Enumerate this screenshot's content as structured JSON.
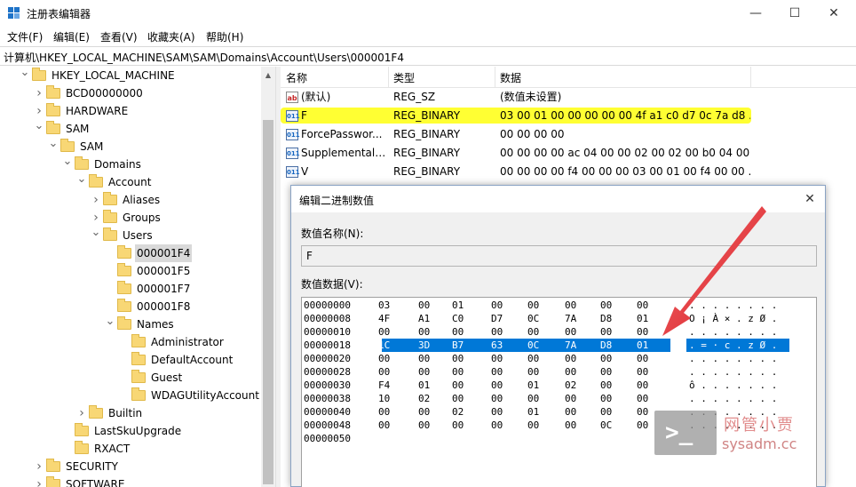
{
  "window": {
    "title": "注册表编辑器",
    "minimize_glyph": "—",
    "maximize_glyph": "☐",
    "close_glyph": "✕",
    "icon": "registry-editor-icon"
  },
  "menu": [
    "文件(F)",
    "编辑(E)",
    "查看(V)",
    "收藏夹(A)",
    "帮助(H)"
  ],
  "address": "计算机\\HKEY_LOCAL_MACHINE\\SAM\\SAM\\Domains\\Account\\Users\\000001F4",
  "tree": [
    {
      "label": "HKEY_LOCAL_MACHINE",
      "chev": "v"
    },
    {
      "label": "BCD00000000",
      "chev": ">"
    },
    {
      "label": "HARDWARE",
      "chev": ">"
    },
    {
      "label": "SAM",
      "chev": "v"
    },
    {
      "label": "SAM",
      "chev": "v"
    },
    {
      "label": "Domains",
      "chev": "v"
    },
    {
      "label": "Account",
      "chev": "v"
    },
    {
      "label": "Aliases",
      "chev": ">"
    },
    {
      "label": "Groups",
      "chev": ">"
    },
    {
      "label": "Users",
      "chev": "v"
    },
    {
      "label": "000001F4",
      "chev": ""
    },
    {
      "label": "000001F5",
      "chev": ""
    },
    {
      "label": "000001F7",
      "chev": ""
    },
    {
      "label": "000001F8",
      "chev": ""
    },
    {
      "label": "Names",
      "chev": "v"
    },
    {
      "label": "Administrator",
      "chev": ""
    },
    {
      "label": "DefaultAccount",
      "chev": ""
    },
    {
      "label": "Guest",
      "chev": ""
    },
    {
      "label": "WDAGUtilityAccount",
      "chev": ""
    },
    {
      "label": "Builtin",
      "chev": ">"
    },
    {
      "label": "LastSkuUpgrade",
      "chev": ""
    },
    {
      "label": "RXACT",
      "chev": ""
    },
    {
      "label": "SECURITY",
      "chev": ">"
    },
    {
      "label": "SOFTWARE",
      "chev": ">"
    }
  ],
  "list": {
    "headers": {
      "name": "名称",
      "type": "类型",
      "data": "数据"
    },
    "rows": [
      {
        "icon": "ab",
        "name": "(默认)",
        "type": "REG_SZ",
        "data": "(数值未设置)"
      },
      {
        "icon": "011",
        "name": "F",
        "type": "REG_BINARY",
        "data": "03 00 01 00 00 00 00 00 4f a1 c0 d7 0c 7a d8 ..."
      },
      {
        "icon": "011",
        "name": "ForcePasswor...",
        "type": "REG_BINARY",
        "data": "00 00 00 00"
      },
      {
        "icon": "011",
        "name": "SupplementalC...",
        "type": "REG_BINARY",
        "data": "00 00 00 00 ac 04 00 00 02 00 02 00 b0 04 00..."
      },
      {
        "icon": "011",
        "name": "V",
        "type": "REG_BINARY",
        "data": "00 00 00 00 f4 00 00 00 03 00 01 00 f4 00 00 ..."
      }
    ]
  },
  "dialog": {
    "title": "编辑二进制数值",
    "close_glyph": "✕",
    "name_label": "数值名称(N):",
    "name_value": "F",
    "data_label": "数值数据(V):",
    "hex_rows": [
      {
        "addr": "00000000",
        "bytes": [
          "03",
          "00",
          "01",
          "00",
          "00",
          "00",
          "00",
          "00"
        ],
        "ascii": ". . . . . . . ."
      },
      {
        "addr": "00000008",
        "bytes": [
          "4F",
          "A1",
          "C0",
          "D7",
          "0C",
          "7A",
          "D8",
          "01"
        ],
        "ascii": "O ¡ À × . z Ø ."
      },
      {
        "addr": "00000010",
        "bytes": [
          "00",
          "00",
          "00",
          "00",
          "00",
          "00",
          "00",
          "00"
        ],
        "ascii": ". . . . . . . ."
      },
      {
        "addr": "00000018",
        "bytes": [
          "1C",
          "3D",
          "B7",
          "63",
          "0C",
          "7A",
          "D8",
          "01"
        ],
        "ascii": ". = · c . z Ø .",
        "selected": true
      },
      {
        "addr": "00000020",
        "bytes": [
          "00",
          "00",
          "00",
          "00",
          "00",
          "00",
          "00",
          "00"
        ],
        "ascii": ". . . . . . . ."
      },
      {
        "addr": "00000028",
        "bytes": [
          "00",
          "00",
          "00",
          "00",
          "00",
          "00",
          "00",
          "00"
        ],
        "ascii": ". . . . . . . ."
      },
      {
        "addr": "00000030",
        "bytes": [
          "F4",
          "01",
          "00",
          "00",
          "01",
          "02",
          "00",
          "00"
        ],
        "ascii": "ô . . . . . . ."
      },
      {
        "addr": "00000038",
        "bytes": [
          "10",
          "02",
          "00",
          "00",
          "00",
          "00",
          "00",
          "00"
        ],
        "ascii": ". . . . . . . ."
      },
      {
        "addr": "00000040",
        "bytes": [
          "00",
          "00",
          "02",
          "00",
          "01",
          "00",
          "00",
          "00"
        ],
        "ascii": ". . . . . . . ."
      },
      {
        "addr": "00000048",
        "bytes": [
          "00",
          "00",
          "00",
          "00",
          "00",
          "00",
          "0C",
          "00"
        ],
        "ascii": ". . . . . . . ."
      },
      {
        "addr": "00000050",
        "bytes": [],
        "ascii": ""
      }
    ]
  },
  "watermark": {
    "line1": "网管小贾",
    "line2": "sysadm.cc",
    "prompt": ">_"
  },
  "colors": {
    "highlight": "#ffff33",
    "selection": "#0078d7",
    "arrow": "#e8262a"
  }
}
